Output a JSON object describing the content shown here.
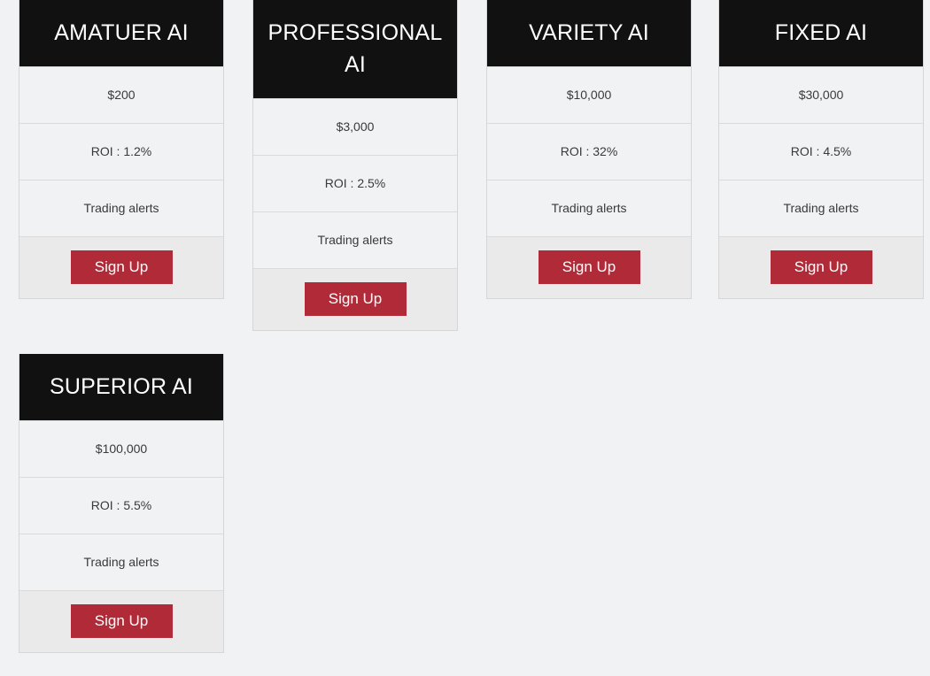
{
  "page": {
    "background_color": "#f1f2f4",
    "layout": "pricing-card-grid"
  },
  "theme": {
    "header_background": "#111111",
    "header_text_color": "#ffffff",
    "row_background": "#f1f2f4",
    "footer_background": "#ebeaea",
    "border_color": "#d4d6d9",
    "button_color": "#b02a37",
    "button_text_color": "#ffffff",
    "body_text_color": "#3a3a3a"
  },
  "cards": [
    {
      "title": "AMATUER AI",
      "price": "$200",
      "roi": "ROI : 1.2%",
      "feature": "Trading alerts",
      "cta": "Sign Up"
    },
    {
      "title": "PROFESSIONAL AI",
      "price": "$3,000",
      "roi": "ROI : 2.5%",
      "feature": "Trading alerts",
      "cta": "Sign Up"
    },
    {
      "title": "VARIETY AI",
      "price": "$10,000",
      "roi": "ROI : 32%",
      "feature": "Trading alerts",
      "cta": "Sign Up"
    },
    {
      "title": "FIXED AI",
      "price": "$30,000",
      "roi": "ROI : 4.5%",
      "feature": "Trading alerts",
      "cta": "Sign Up"
    },
    {
      "title": "SUPERIOR AI",
      "price": "$100,000",
      "roi": "ROI : 5.5%",
      "feature": "Trading alerts",
      "cta": "Sign Up"
    }
  ]
}
